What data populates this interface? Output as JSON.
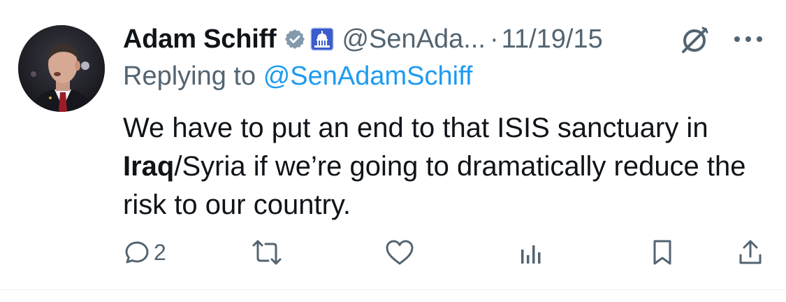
{
  "tweet": {
    "author": {
      "name": "Adam Schiff",
      "handle": "@SenAda...",
      "avatar_icon": "avatar-photo"
    },
    "separator": "·",
    "date": "11/19/15",
    "reply": {
      "prefix": "Replying to",
      "mention": "@SenAdamSchiff"
    },
    "text": {
      "part1": "We have to put an end to that ISIS sanctuary in ",
      "bold": "Iraq",
      "part2": "/Syria if we’re going to dramatically reduce the risk to our country."
    },
    "actions": {
      "reply_count": "2"
    },
    "icons": {
      "verified": "verified-badge-icon",
      "org": "capitol-badge-icon",
      "grok": "grok-icon",
      "more": "more-icon",
      "reply": "reply-icon",
      "retweet": "retweet-icon",
      "like": "like-icon",
      "views": "views-icon",
      "bookmark": "bookmark-icon",
      "share": "share-icon"
    },
    "colors": {
      "text": "#0f1419",
      "secondary": "#536471",
      "link": "#1d9bf0",
      "verified": "#829aab",
      "org_badge": "#3b5ccc"
    }
  }
}
